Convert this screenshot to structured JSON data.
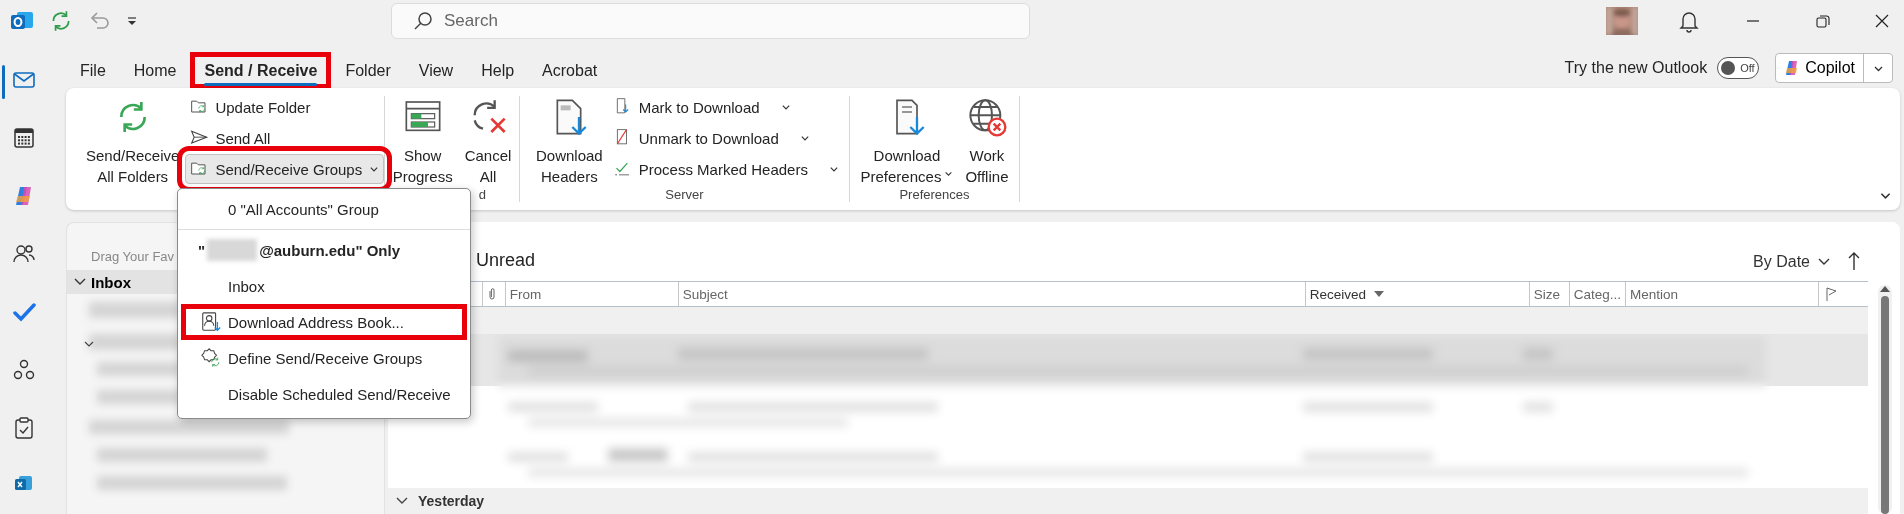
{
  "title_bar": {
    "search": {
      "placeholder": "Search"
    }
  },
  "tabs": [
    {
      "label": "File",
      "selected": false,
      "highlighted": false
    },
    {
      "label": "Home",
      "selected": false,
      "highlighted": false
    },
    {
      "label": "Send / Receive",
      "selected": true,
      "highlighted": true
    },
    {
      "label": "Folder",
      "selected": false,
      "highlighted": false
    },
    {
      "label": "View",
      "selected": false,
      "highlighted": false
    },
    {
      "label": "Help",
      "selected": false,
      "highlighted": false
    },
    {
      "label": "Acrobat",
      "selected": false,
      "highlighted": false
    }
  ],
  "new_outlook": {
    "label": "Try the new Outlook",
    "toggle": {
      "on": false,
      "label": "Off"
    }
  },
  "copilot_button": {
    "label": "Copilot"
  },
  "ribbon": {
    "groups": [
      {
        "buttons": [
          {
            "kind": "large",
            "lines": [
              "Send/Receive",
              "All Folders"
            ],
            "dropdown": false
          },
          {
            "kind": "small",
            "label": "Update Folder",
            "dropdown": false,
            "expanded": false,
            "highlighted": false
          },
          {
            "kind": "small",
            "label": "Send All",
            "dropdown": false,
            "expanded": false,
            "highlighted": false
          },
          {
            "kind": "small",
            "label": "Send/Receive Groups",
            "dropdown": true,
            "expanded": true,
            "highlighted": true
          }
        ]
      },
      {
        "label": "d",
        "buttons": [
          {
            "kind": "large",
            "lines": [
              "Show",
              "Progress"
            ],
            "dropdown": false
          },
          {
            "kind": "large",
            "lines": [
              "Cancel",
              "All"
            ],
            "dropdown": false
          }
        ]
      },
      {
        "label": "Server",
        "buttons": [
          {
            "kind": "large",
            "lines": [
              "Download",
              "Headers"
            ],
            "dropdown": false
          },
          {
            "kind": "small",
            "label": "Mark to Download",
            "dropdown": true,
            "expanded": false,
            "highlighted": false
          },
          {
            "kind": "small",
            "label": "Unmark to Download",
            "dropdown": true,
            "expanded": false,
            "highlighted": false
          },
          {
            "kind": "small",
            "label": "Process Marked Headers",
            "dropdown": true,
            "expanded": false,
            "highlighted": false
          }
        ]
      },
      {
        "label": "Preferences",
        "buttons": [
          {
            "kind": "large",
            "lines": [
              "Download",
              "Preferences"
            ],
            "dropdown": true
          },
          {
            "kind": "large",
            "lines": [
              "Work",
              "Offline"
            ],
            "dropdown": false
          }
        ]
      }
    ]
  },
  "menu": {
    "items": [
      {
        "kind": "item",
        "label": "0 \"All Accounts\" Group",
        "highlighted": false
      },
      {
        "kind": "separator"
      },
      {
        "kind": "account",
        "prefix": "\"",
        "suffix": "@auburn.edu\" Only"
      },
      {
        "kind": "item",
        "label": "Inbox",
        "highlighted": false
      },
      {
        "kind": "item",
        "label": "Download Address Book...",
        "highlighted": true
      },
      {
        "kind": "item",
        "label": "Define Send/Receive Groups",
        "highlighted": false
      },
      {
        "kind": "item",
        "label": "Disable Scheduled Send/Receive",
        "highlighted": false
      }
    ]
  },
  "navigation": {
    "hint": "Drag Your Fav",
    "folders": [
      {
        "label": "Inbox",
        "expanded": true,
        "selected": true
      }
    ]
  },
  "message_list": {
    "filter": "Unread",
    "sort": {
      "label": "By Date"
    },
    "columns": [
      {
        "label": "From",
        "sorted": false
      },
      {
        "label": "Subject",
        "sorted": false
      },
      {
        "label": "Received",
        "sorted": true
      },
      {
        "label": "Size",
        "sorted": false
      },
      {
        "label": "Categ...",
        "sorted": false
      },
      {
        "label": "Mention",
        "sorted": false
      }
    ],
    "groups": [
      {
        "label": "Yesterday",
        "expanded": true
      }
    ]
  }
}
